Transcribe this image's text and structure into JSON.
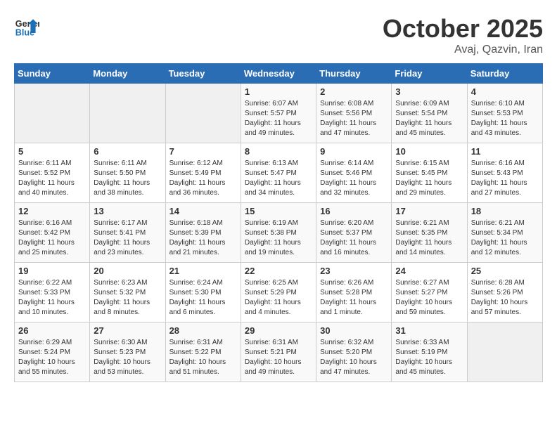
{
  "logo": {
    "general": "General",
    "blue": "Blue"
  },
  "title": "October 2025",
  "subtitle": "Avaj, Qazvin, Iran",
  "headers": [
    "Sunday",
    "Monday",
    "Tuesday",
    "Wednesday",
    "Thursday",
    "Friday",
    "Saturday"
  ],
  "weeks": [
    [
      {
        "day": "",
        "sunrise": "",
        "sunset": "",
        "daylight": ""
      },
      {
        "day": "",
        "sunrise": "",
        "sunset": "",
        "daylight": ""
      },
      {
        "day": "",
        "sunrise": "",
        "sunset": "",
        "daylight": ""
      },
      {
        "day": "1",
        "sunrise": "Sunrise: 6:07 AM",
        "sunset": "Sunset: 5:57 PM",
        "daylight": "Daylight: 11 hours and 49 minutes."
      },
      {
        "day": "2",
        "sunrise": "Sunrise: 6:08 AM",
        "sunset": "Sunset: 5:56 PM",
        "daylight": "Daylight: 11 hours and 47 minutes."
      },
      {
        "day": "3",
        "sunrise": "Sunrise: 6:09 AM",
        "sunset": "Sunset: 5:54 PM",
        "daylight": "Daylight: 11 hours and 45 minutes."
      },
      {
        "day": "4",
        "sunrise": "Sunrise: 6:10 AM",
        "sunset": "Sunset: 5:53 PM",
        "daylight": "Daylight: 11 hours and 43 minutes."
      }
    ],
    [
      {
        "day": "5",
        "sunrise": "Sunrise: 6:11 AM",
        "sunset": "Sunset: 5:52 PM",
        "daylight": "Daylight: 11 hours and 40 minutes."
      },
      {
        "day": "6",
        "sunrise": "Sunrise: 6:11 AM",
        "sunset": "Sunset: 5:50 PM",
        "daylight": "Daylight: 11 hours and 38 minutes."
      },
      {
        "day": "7",
        "sunrise": "Sunrise: 6:12 AM",
        "sunset": "Sunset: 5:49 PM",
        "daylight": "Daylight: 11 hours and 36 minutes."
      },
      {
        "day": "8",
        "sunrise": "Sunrise: 6:13 AM",
        "sunset": "Sunset: 5:47 PM",
        "daylight": "Daylight: 11 hours and 34 minutes."
      },
      {
        "day": "9",
        "sunrise": "Sunrise: 6:14 AM",
        "sunset": "Sunset: 5:46 PM",
        "daylight": "Daylight: 11 hours and 32 minutes."
      },
      {
        "day": "10",
        "sunrise": "Sunrise: 6:15 AM",
        "sunset": "Sunset: 5:45 PM",
        "daylight": "Daylight: 11 hours and 29 minutes."
      },
      {
        "day": "11",
        "sunrise": "Sunrise: 6:16 AM",
        "sunset": "Sunset: 5:43 PM",
        "daylight": "Daylight: 11 hours and 27 minutes."
      }
    ],
    [
      {
        "day": "12",
        "sunrise": "Sunrise: 6:16 AM",
        "sunset": "Sunset: 5:42 PM",
        "daylight": "Daylight: 11 hours and 25 minutes."
      },
      {
        "day": "13",
        "sunrise": "Sunrise: 6:17 AM",
        "sunset": "Sunset: 5:41 PM",
        "daylight": "Daylight: 11 hours and 23 minutes."
      },
      {
        "day": "14",
        "sunrise": "Sunrise: 6:18 AM",
        "sunset": "Sunset: 5:39 PM",
        "daylight": "Daylight: 11 hours and 21 minutes."
      },
      {
        "day": "15",
        "sunrise": "Sunrise: 6:19 AM",
        "sunset": "Sunset: 5:38 PM",
        "daylight": "Daylight: 11 hours and 19 minutes."
      },
      {
        "day": "16",
        "sunrise": "Sunrise: 6:20 AM",
        "sunset": "Sunset: 5:37 PM",
        "daylight": "Daylight: 11 hours and 16 minutes."
      },
      {
        "day": "17",
        "sunrise": "Sunrise: 6:21 AM",
        "sunset": "Sunset: 5:35 PM",
        "daylight": "Daylight: 11 hours and 14 minutes."
      },
      {
        "day": "18",
        "sunrise": "Sunrise: 6:21 AM",
        "sunset": "Sunset: 5:34 PM",
        "daylight": "Daylight: 11 hours and 12 minutes."
      }
    ],
    [
      {
        "day": "19",
        "sunrise": "Sunrise: 6:22 AM",
        "sunset": "Sunset: 5:33 PM",
        "daylight": "Daylight: 11 hours and 10 minutes."
      },
      {
        "day": "20",
        "sunrise": "Sunrise: 6:23 AM",
        "sunset": "Sunset: 5:32 PM",
        "daylight": "Daylight: 11 hours and 8 minutes."
      },
      {
        "day": "21",
        "sunrise": "Sunrise: 6:24 AM",
        "sunset": "Sunset: 5:30 PM",
        "daylight": "Daylight: 11 hours and 6 minutes."
      },
      {
        "day": "22",
        "sunrise": "Sunrise: 6:25 AM",
        "sunset": "Sunset: 5:29 PM",
        "daylight": "Daylight: 11 hours and 4 minutes."
      },
      {
        "day": "23",
        "sunrise": "Sunrise: 6:26 AM",
        "sunset": "Sunset: 5:28 PM",
        "daylight": "Daylight: 11 hours and 1 minute."
      },
      {
        "day": "24",
        "sunrise": "Sunrise: 6:27 AM",
        "sunset": "Sunset: 5:27 PM",
        "daylight": "Daylight: 10 hours and 59 minutes."
      },
      {
        "day": "25",
        "sunrise": "Sunrise: 6:28 AM",
        "sunset": "Sunset: 5:26 PM",
        "daylight": "Daylight: 10 hours and 57 minutes."
      }
    ],
    [
      {
        "day": "26",
        "sunrise": "Sunrise: 6:29 AM",
        "sunset": "Sunset: 5:24 PM",
        "daylight": "Daylight: 10 hours and 55 minutes."
      },
      {
        "day": "27",
        "sunrise": "Sunrise: 6:30 AM",
        "sunset": "Sunset: 5:23 PM",
        "daylight": "Daylight: 10 hours and 53 minutes."
      },
      {
        "day": "28",
        "sunrise": "Sunrise: 6:31 AM",
        "sunset": "Sunset: 5:22 PM",
        "daylight": "Daylight: 10 hours and 51 minutes."
      },
      {
        "day": "29",
        "sunrise": "Sunrise: 6:31 AM",
        "sunset": "Sunset: 5:21 PM",
        "daylight": "Daylight: 10 hours and 49 minutes."
      },
      {
        "day": "30",
        "sunrise": "Sunrise: 6:32 AM",
        "sunset": "Sunset: 5:20 PM",
        "daylight": "Daylight: 10 hours and 47 minutes."
      },
      {
        "day": "31",
        "sunrise": "Sunrise: 6:33 AM",
        "sunset": "Sunset: 5:19 PM",
        "daylight": "Daylight: 10 hours and 45 minutes."
      },
      {
        "day": "",
        "sunrise": "",
        "sunset": "",
        "daylight": ""
      }
    ]
  ]
}
